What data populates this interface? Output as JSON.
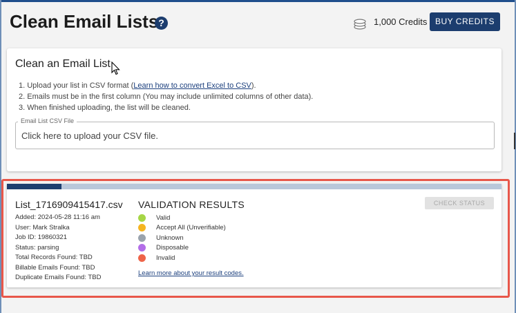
{
  "header": {
    "title": "Clean Email Lists",
    "help_icon": "?",
    "credits_icon": "coins-icon",
    "credits": "1,000 Credits",
    "buy_label": "BUY CREDITS"
  },
  "upload_card": {
    "title": "Clean an Email List",
    "step1_prefix": "1. Upload your list in CSV format (",
    "step1_link": "Learn how to convert Excel to CSV",
    "step1_suffix": ").",
    "step2": "2. Emails must be in the first column (You may include unlimited columns of other data).",
    "step3": "3. When finished uploading, the list will be cleaned.",
    "file_legend": "Email List CSV File",
    "file_placeholder": "Click here to upload your CSV file."
  },
  "job_card": {
    "progress": 0.11,
    "filename": "List_1716909415417.csv",
    "added": "Added: 2024-05-28 11:16 am",
    "user": "User: Mark Stralka",
    "job_id": "Job ID: 19860321",
    "status": "Status: parsing",
    "total_records": "Total Records Found: TBD",
    "billable": "Billable Emails Found: TBD",
    "duplicates": "Duplicate Emails Found: TBD",
    "validation_title": "VALIDATION RESULTS",
    "legend": [
      {
        "label": "Valid",
        "color": "#a6d646"
      },
      {
        "label": "Accept All (Unverifiable)",
        "color": "#f5b521"
      },
      {
        "label": "Unknown",
        "color": "#9aa3ad"
      },
      {
        "label": "Disposable",
        "color": "#b36ee8"
      },
      {
        "label": "Invalid",
        "color": "#ee6449"
      }
    ],
    "learn_more": "Learn more about your result codes.",
    "check_status_label": "CHECK STATUS"
  }
}
